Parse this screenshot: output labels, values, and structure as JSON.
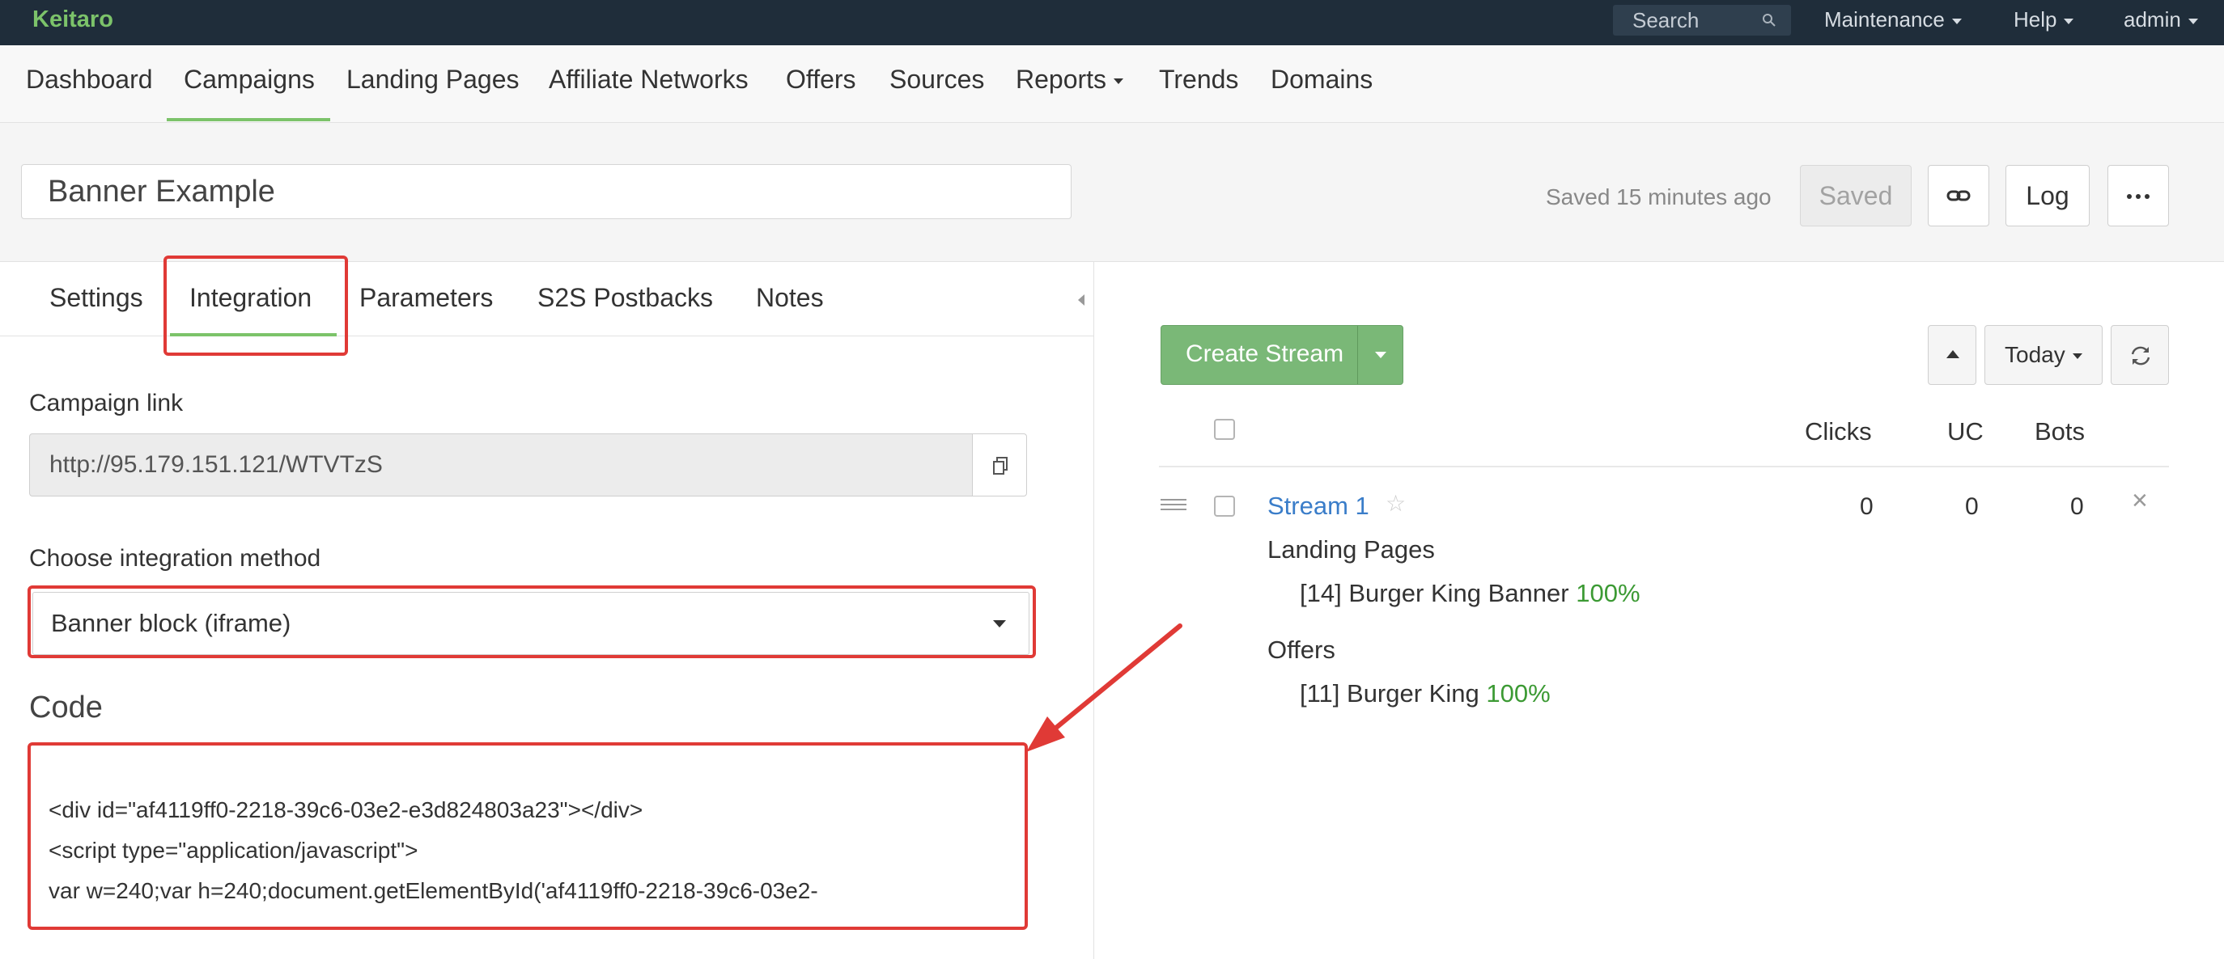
{
  "topbar": {
    "brand": "Keitaro",
    "search_placeholder": "Search",
    "menus": [
      "Maintenance",
      "Help",
      "admin"
    ]
  },
  "nav": {
    "items": [
      "Dashboard",
      "Campaigns",
      "Landing Pages",
      "Affiliate Networks",
      "Offers",
      "Sources",
      "Reports",
      "Trends",
      "Domains"
    ],
    "active": "Campaigns"
  },
  "campaign": {
    "name": "Banner Example",
    "saved_status": "Saved 15 minutes ago",
    "saved_button": "Saved",
    "log_button": "Log"
  },
  "tabs": {
    "items": [
      "Settings",
      "Integration",
      "Parameters",
      "S2S Postbacks",
      "Notes"
    ],
    "active": "Integration"
  },
  "integration": {
    "campaign_link_label": "Campaign link",
    "campaign_link": "http://95.179.151.121/WTVTzS",
    "method_label": "Choose integration method",
    "method_value": "Banner block (iframe)",
    "code_label": "Code",
    "code_lines": [
      "<div id=\"af4119ff0-2218-39c6-03e2-e3d824803a23\"></div>",
      "<script type=\"application/javascript\">",
      "var w=240;var h=240;document.getElementById('af4119ff0-2218-39c6-03e2-"
    ]
  },
  "streams": {
    "create_button": "Create Stream",
    "period": "Today",
    "columns": [
      "Clicks",
      "UC",
      "Bots"
    ],
    "rows": [
      {
        "name": "Stream 1",
        "clicks": "0",
        "uc": "0",
        "bots": "0",
        "landing_pages_label": "Landing Pages",
        "landing_pages": [
          {
            "name": "[14] Burger King Banner",
            "share": "100%"
          }
        ],
        "offers_label": "Offers",
        "offers": [
          {
            "name": "[11] Burger King",
            "share": "100%"
          }
        ]
      }
    ]
  },
  "colors": {
    "topbar_bg": "#1f2d3a",
    "brand_green": "#7cc36a",
    "button_green": "#7ab877",
    "link_blue": "#3a7dc9",
    "percent_green": "#3c9a34",
    "highlight_red": "#e03a36"
  }
}
